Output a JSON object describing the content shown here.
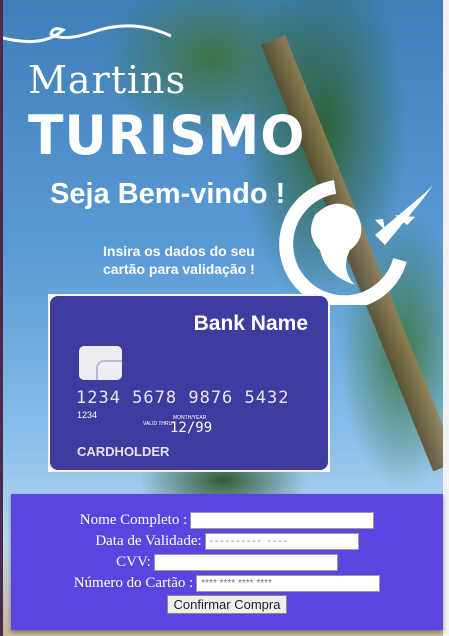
{
  "header": {
    "brand_line1": "Martins",
    "brand_line2": "TURISMO",
    "welcome": "Seja Bem-vindo !",
    "instruction": "Insira os dados do seu cartão para validação !"
  },
  "card": {
    "bank_name": "Bank Name",
    "number": "1234 5678 9876 5432",
    "small_number": "1234",
    "valid_thru_label": "VALID THRU",
    "month_year_label": "MONTH/YEAR",
    "expiry": "12/99",
    "holder": "CARDHOLDER"
  },
  "form": {
    "name_label": "Nome Completo :",
    "name_value": "",
    "date_label": "Data de Validade:",
    "date_placeholder": "---------- ----",
    "cvv_label": "CVV:",
    "cvv_value": "",
    "card_number_label": "Número do Cartão :",
    "card_number_placeholder": "**** **** **** ****",
    "submit_label": "Confirmar Compra"
  },
  "colors": {
    "form_bg": "#5a45e0",
    "card_bg": "#3e3c9e"
  }
}
